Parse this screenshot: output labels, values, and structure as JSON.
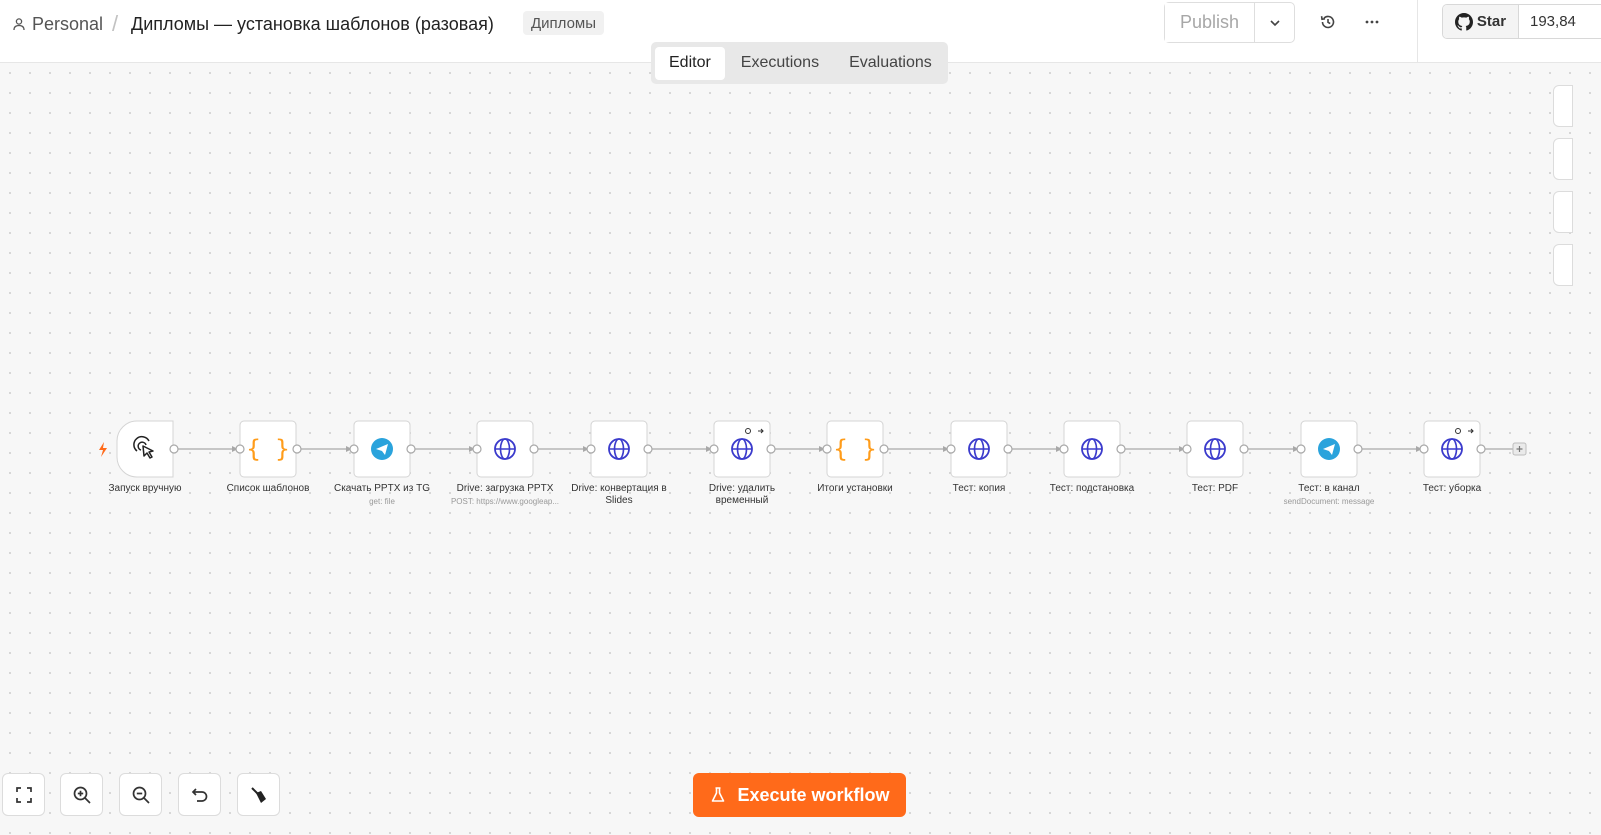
{
  "header": {
    "breadcrumb_personal": "Personal",
    "workflow_title": "Дипломы — установка шаблонов (разовая)",
    "tag": "Дипломы",
    "publish_label": "Publish",
    "github_star_label": "Star",
    "github_star_count": "193,84"
  },
  "tabs": [
    {
      "label": "Editor",
      "active": true
    },
    {
      "label": "Executions",
      "active": false
    },
    {
      "label": "Evaluations",
      "active": false
    }
  ],
  "nodes": [
    {
      "label": "Запуск вручную",
      "sub": "",
      "icon": "cursor-click-icon"
    },
    {
      "label": "Список шаблонов",
      "sub": "",
      "icon": "code-braces-icon"
    },
    {
      "label": "Скачать PPTX из TG",
      "sub": "get: file",
      "icon": "telegram-icon"
    },
    {
      "label": "Drive: загрузка PPTX",
      "sub": "POST: https://www.googleap...",
      "icon": "globe-icon"
    },
    {
      "label": "Drive: конвертация в Slides",
      "sub": "",
      "icon": "globe-icon"
    },
    {
      "label": "Drive: удалить временный",
      "sub": "",
      "icon": "globe-icon"
    },
    {
      "label": "Итоги установки",
      "sub": "",
      "icon": "code-braces-icon"
    },
    {
      "label": "Тест: копия",
      "sub": "",
      "icon": "globe-icon"
    },
    {
      "label": "Тест: подстановка",
      "sub": "",
      "icon": "globe-icon"
    },
    {
      "label": "Тест: PDF",
      "sub": "",
      "icon": "globe-icon"
    },
    {
      "label": "Тест: в канал",
      "sub": "sendDocument: message",
      "icon": "telegram-icon"
    },
    {
      "label": "Тест: уборка",
      "sub": "",
      "icon": "globe-icon"
    }
  ],
  "execute_label": "Execute workflow",
  "colors": {
    "accent": "#ff6a1a",
    "globe": "#3b3bcc",
    "code": "#ff9c1a",
    "telegram": "#2aa3dc"
  }
}
